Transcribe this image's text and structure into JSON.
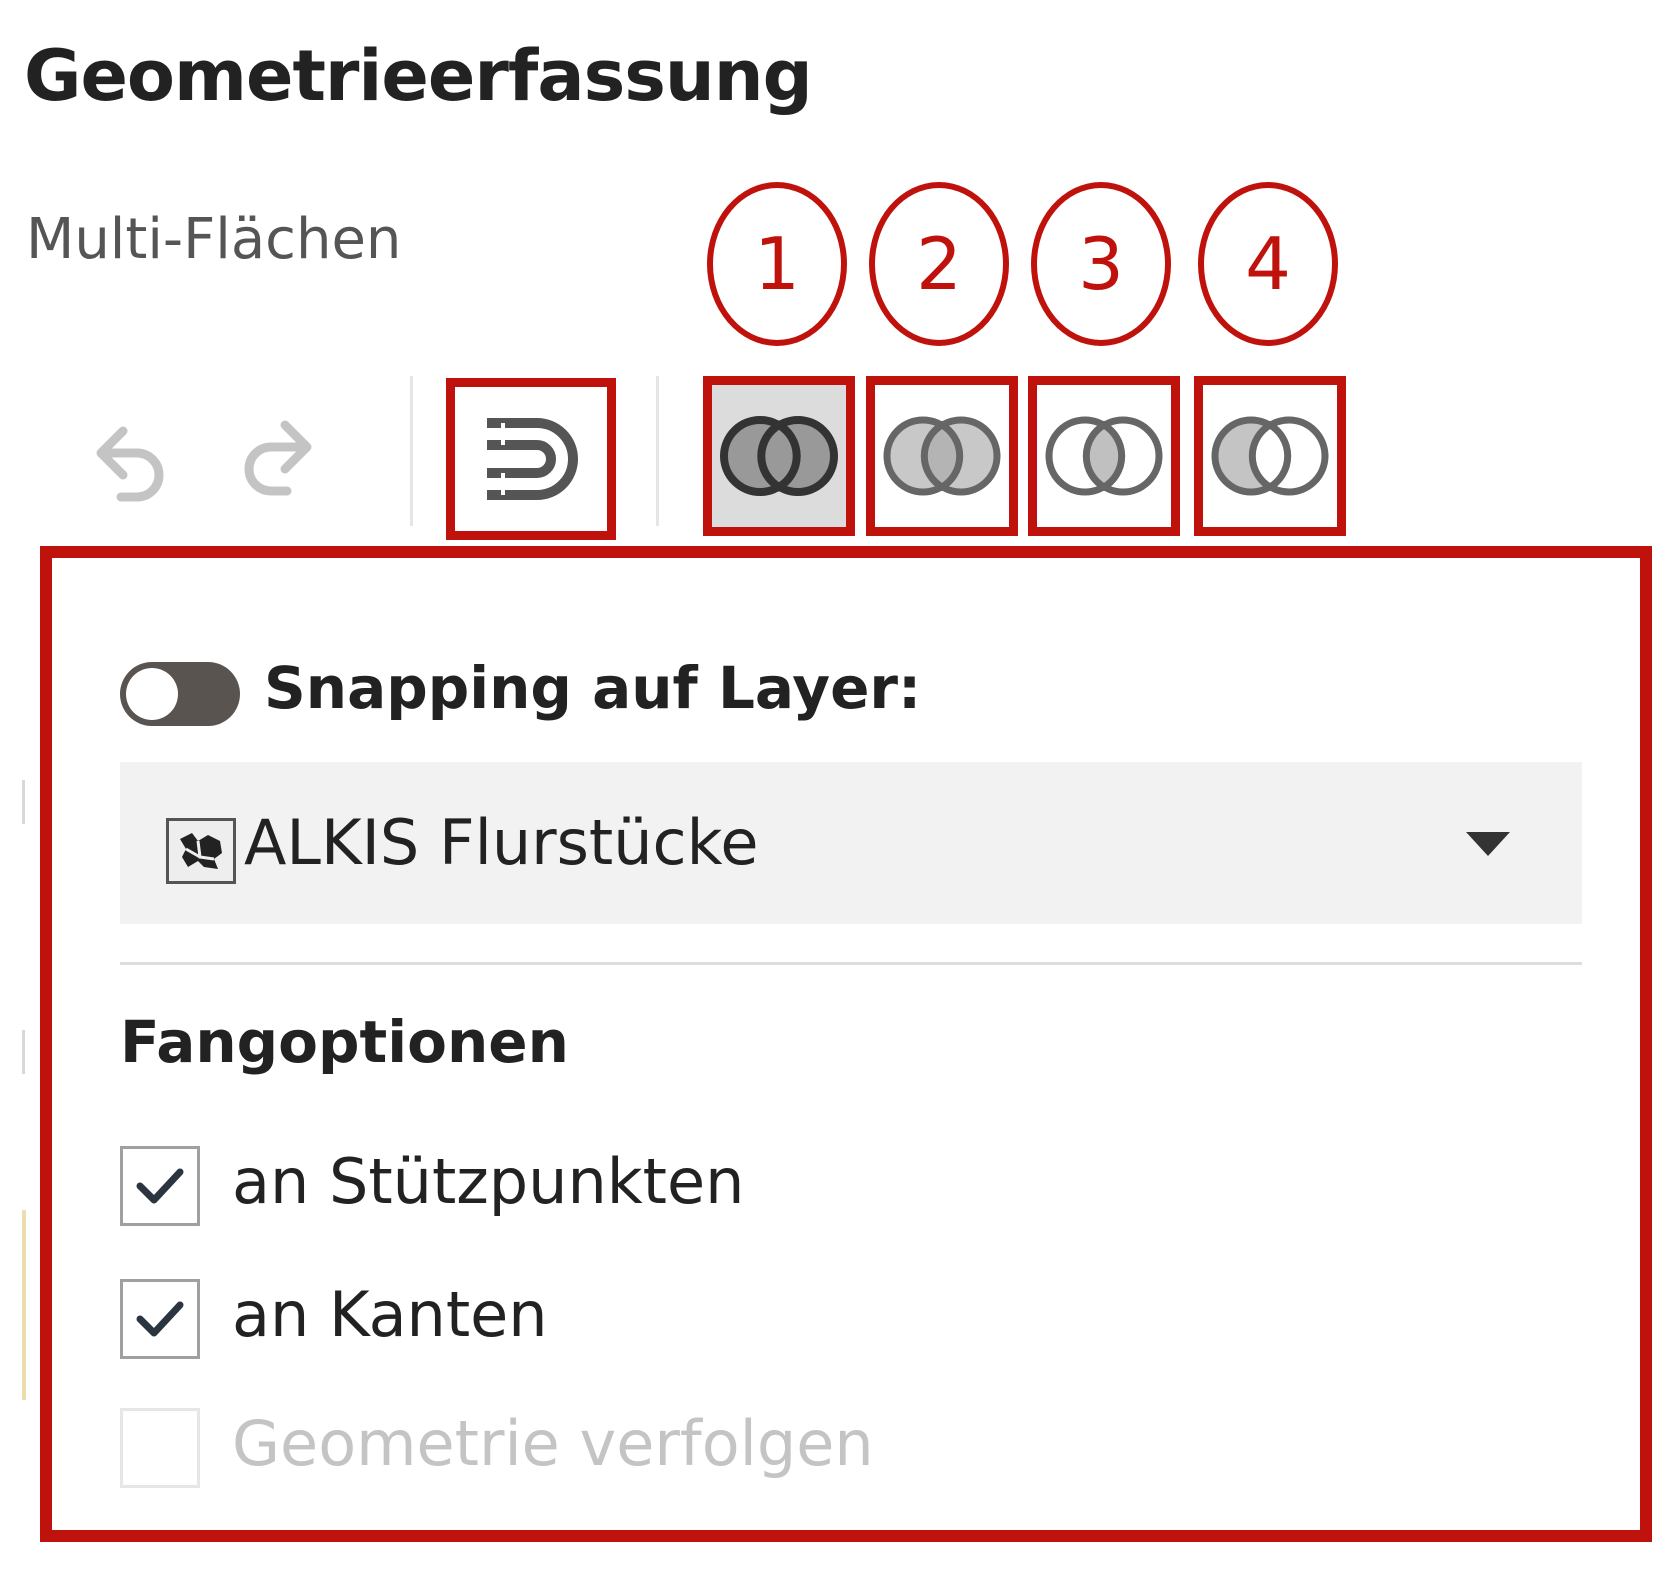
{
  "header": {
    "title": "Geometrieerfassung",
    "subtitle": "Multi-Flächen"
  },
  "annotations": [
    "1",
    "2",
    "3",
    "4"
  ],
  "toolbar": {
    "undo_icon": "undo-icon",
    "redo_icon": "redo-icon",
    "snapping_icon": "magnet-icon",
    "operations": [
      {
        "icon": "union-icon",
        "active": true
      },
      {
        "icon": "difference-icon",
        "active": false
      },
      {
        "icon": "intersection-icon",
        "active": false
      },
      {
        "icon": "split-icon",
        "active": false
      }
    ]
  },
  "snapping_panel": {
    "toggle_label": "Snapping auf Layer:",
    "toggle_on": false,
    "layer_select": {
      "value": "ALKIS Flurstücke",
      "icon": "layer-map-icon"
    },
    "options_heading": "Fangoptionen",
    "options": [
      {
        "label": "an Stützpunkten",
        "checked": true,
        "disabled": false
      },
      {
        "label": "an Kanten",
        "checked": true,
        "disabled": false
      },
      {
        "label": "Geometrie verfolgen",
        "checked": false,
        "disabled": true
      }
    ]
  },
  "colors": {
    "annotation_red": "#c0120c",
    "text_dark": "#222222",
    "toggle_off": "#5a5450",
    "select_bg": "#f2f2f2"
  }
}
